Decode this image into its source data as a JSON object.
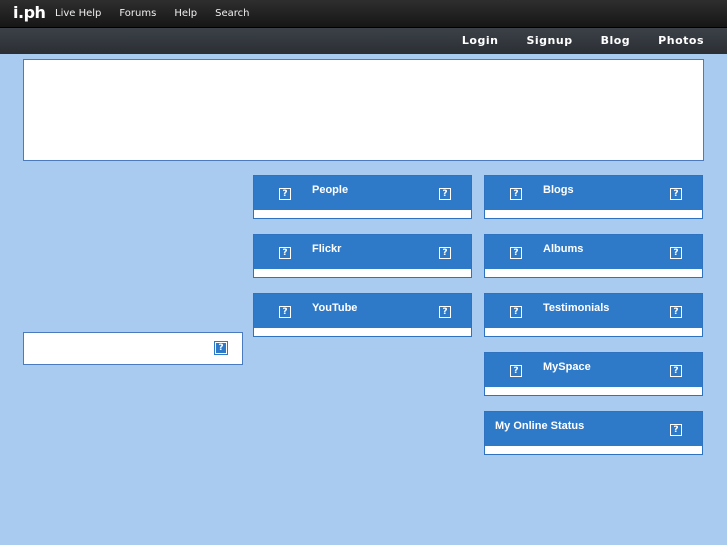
{
  "logo": "i.ph",
  "topnav": [
    "Live Help",
    "Forums",
    "Help",
    "Search"
  ],
  "subnav": [
    "Login",
    "Signup",
    "Blog",
    "Photos"
  ],
  "help_glyph": "?",
  "widgets": {
    "people": "People",
    "flickr": "Flickr",
    "youtube": "YouTube",
    "blogs": "Blogs",
    "albums": "Albums",
    "testimonials": "Testimonials",
    "myspace": "MySpace",
    "status": "My Online Status"
  },
  "colors": {
    "background": "#a9cbef",
    "widget_header": "#2f7ac8",
    "topbar": "#1e1e1e"
  }
}
